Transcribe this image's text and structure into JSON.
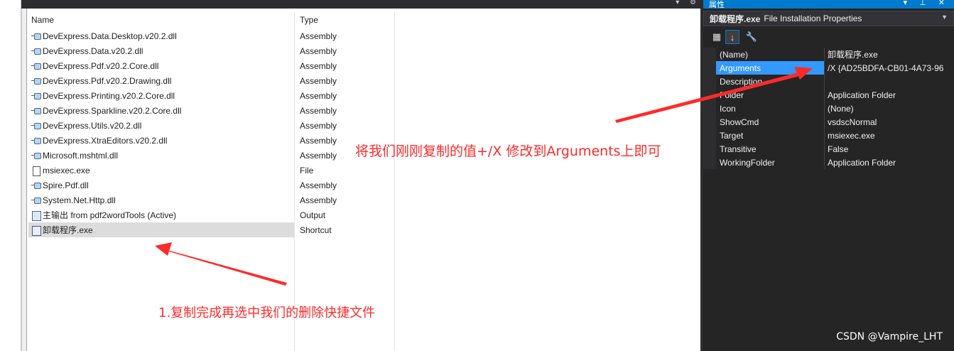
{
  "file_list": {
    "header": {
      "name": "Name",
      "type": "Type"
    },
    "rows": [
      {
        "name": "DevExpress.Data.Desktop.v20.2.dll",
        "type": "Assembly",
        "icon": "assembly-icon"
      },
      {
        "name": "DevExpress.Data.v20.2.dll",
        "type": "Assembly",
        "icon": "assembly-icon"
      },
      {
        "name": "DevExpress.Pdf.v20.2.Core.dll",
        "type": "Assembly",
        "icon": "assembly-icon"
      },
      {
        "name": "DevExpress.Pdf.v20.2.Drawing.dll",
        "type": "Assembly",
        "icon": "assembly-icon"
      },
      {
        "name": "DevExpress.Printing.v20.2.Core.dll",
        "type": "Assembly",
        "icon": "assembly-icon"
      },
      {
        "name": "DevExpress.Sparkline.v20.2.Core.dll",
        "type": "Assembly",
        "icon": "assembly-icon"
      },
      {
        "name": "DevExpress.Utils.v20.2.dll",
        "type": "Assembly",
        "icon": "assembly-icon"
      },
      {
        "name": "DevExpress.XtraEditors.v20.2.dll",
        "type": "Assembly",
        "icon": "assembly-icon"
      },
      {
        "name": "Microsoft.mshtml.dll",
        "type": "Assembly",
        "icon": "assembly-icon"
      },
      {
        "name": "msiexec.exe",
        "type": "File",
        "icon": "file-icon"
      },
      {
        "name": "Spire.Pdf.dll",
        "type": "Assembly",
        "icon": "assembly-icon"
      },
      {
        "name": "System.Net.Http.dll",
        "type": "Assembly",
        "icon": "assembly-icon"
      },
      {
        "name": "主输出 from pdf2wordTools (Active)",
        "type": "Output",
        "icon": "output-icon"
      },
      {
        "name": "卸载程序.exe",
        "type": "Shortcut",
        "icon": "shortcut-icon",
        "selected": true
      }
    ]
  },
  "properties": {
    "title": "属性",
    "object_name": "卸载程序.exe",
    "object_type": "File Installation Properties",
    "rows": [
      {
        "name": "(Name)",
        "value": "卸载程序.exe"
      },
      {
        "name": "Arguments",
        "value": "/X {AD25BDFA-CB01-4A73-96",
        "selected": true
      },
      {
        "name": "Description",
        "value": ""
      },
      {
        "name": "Folder",
        "value": "Application Folder"
      },
      {
        "name": "Icon",
        "value": "(None)"
      },
      {
        "name": "ShowCmd",
        "value": "vsdscNormal"
      },
      {
        "name": "Target",
        "value": "msiexec.exe"
      },
      {
        "name": "Transitive",
        "value": "False"
      },
      {
        "name": "WorkingFolder",
        "value": "Application Folder"
      }
    ]
  },
  "annotations": {
    "note_arguments": "将我们刚刚复制的值+/X 修改到Arguments上即可",
    "note_select": "1.复制完成再选中我们的删除快捷文件",
    "color": "#ff2a2a"
  },
  "watermark": "CSDN @Vampire_LHT",
  "colors": {
    "accent": "#007acc",
    "selected_property": "#3399ff",
    "selected_file_row": "#dcdcdc"
  }
}
